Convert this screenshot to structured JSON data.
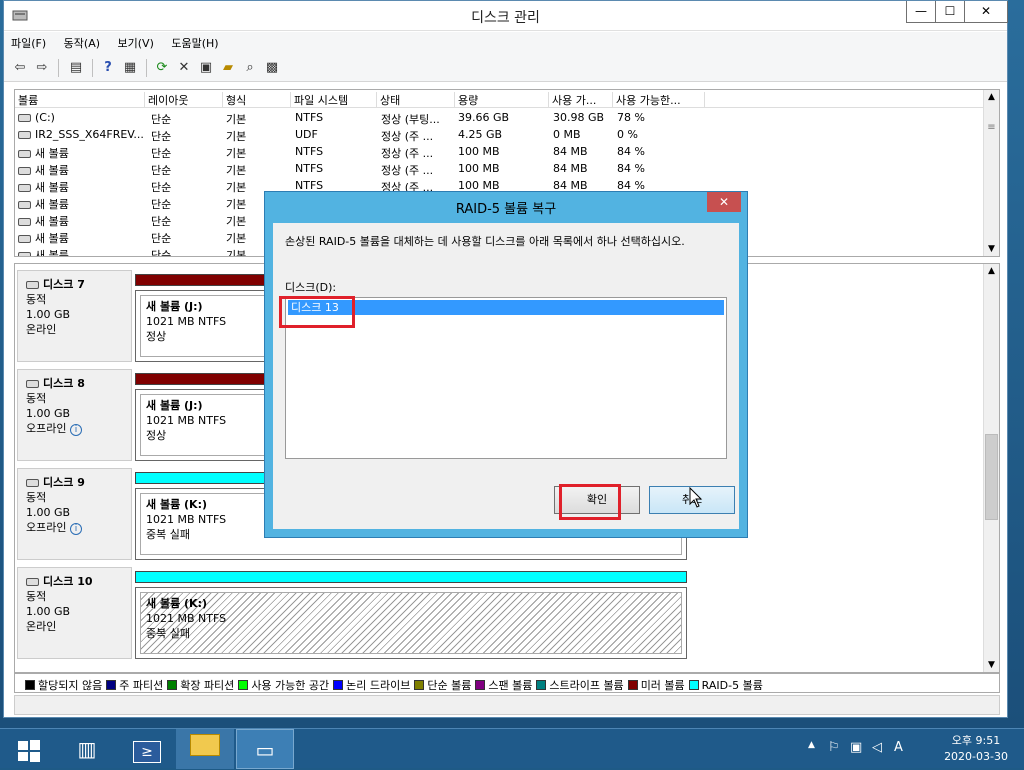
{
  "window": {
    "title": "디스크 관리",
    "buttons": {
      "min": "—",
      "max": "☐",
      "close": "✕"
    }
  },
  "menu": [
    "파일(F)",
    "동작(A)",
    "보기(V)",
    "도움말(H)"
  ],
  "volume_table": {
    "columns": [
      "볼륨",
      "레이아웃",
      "형식",
      "파일 시스템",
      "상태",
      "용량",
      "사용 가...",
      "사용 가능한..."
    ],
    "rows": [
      [
        "(C:)",
        "단순",
        "기본",
        "NTFS",
        "정상 (부팅...",
        "39.66 GB",
        "30.98 GB",
        "78 %"
      ],
      [
        "IR2_SSS_X64FREV...",
        "단순",
        "기본",
        "UDF",
        "정상 (주 ...",
        "4.25 GB",
        "0 MB",
        "0 %"
      ],
      [
        "새 볼륨",
        "단순",
        "기본",
        "NTFS",
        "정상 (주 ...",
        "100 MB",
        "84 MB",
        "84 %"
      ],
      [
        "새 볼륨",
        "단순",
        "기본",
        "NTFS",
        "정상 (주 ...",
        "100 MB",
        "84 MB",
        "84 %"
      ],
      [
        "새 볼륨",
        "단순",
        "기본",
        "NTFS",
        "정상 (주 ...",
        "100 MB",
        "84 MB",
        "84 %"
      ],
      [
        "새 볼륨",
        "단순",
        "기본",
        "",
        "",
        "",
        "",
        ""
      ],
      [
        "새 볼륨",
        "단순",
        "기본",
        "",
        "",
        "",
        "",
        ""
      ],
      [
        "새 볼륨",
        "단순",
        "기본",
        "",
        "",
        "",
        "",
        ""
      ],
      [
        "새 볼륨",
        "단순",
        "기본",
        "",
        "",
        "",
        "",
        ""
      ]
    ]
  },
  "disks": [
    {
      "name": "디스크 7",
      "type": "동적",
      "size": "1.00 GB",
      "status": "온라인",
      "bar_color": "#800000",
      "part_name": "새 볼륨  (J:)",
      "part_size": "1021 MB NTFS",
      "part_status": "정상",
      "hatched": false,
      "info": false
    },
    {
      "name": "디스크 8",
      "type": "동적",
      "size": "1.00 GB",
      "status": "오프라인",
      "bar_color": "#800000",
      "part_name": "새 볼륨  (J:)",
      "part_size": "1021 MB NTFS",
      "part_status": "정상",
      "hatched": false,
      "info": true
    },
    {
      "name": "디스크 9",
      "type": "동적",
      "size": "1.00 GB",
      "status": "오프라인",
      "bar_color": "#00ffff",
      "part_name": "새 볼륨  (K:)",
      "part_size": "1021 MB NTFS",
      "part_status": "중복 실패",
      "hatched": false,
      "info": true
    },
    {
      "name": "디스크 10",
      "type": "동적",
      "size": "1.00 GB",
      "status": "온라인",
      "bar_color": "#00ffff",
      "part_name": "새 볼륨  (K:)",
      "part_size": "1021 MB NTFS",
      "part_status": "중복 실패",
      "hatched": true,
      "info": false
    }
  ],
  "legend": [
    {
      "label": "할당되지 않음",
      "color": "#000000"
    },
    {
      "label": "주 파티션",
      "color": "#000080"
    },
    {
      "label": "확장 파티션",
      "color": "#008000"
    },
    {
      "label": "사용 가능한 공간",
      "color": "#00ff00"
    },
    {
      "label": "논리 드라이브",
      "color": "#0000ff"
    },
    {
      "label": "단순 볼륨",
      "color": "#808000"
    },
    {
      "label": "스팬 볼륨",
      "color": "#800080"
    },
    {
      "label": "스트라이프 볼륨",
      "color": "#008080"
    },
    {
      "label": "미러 볼륨",
      "color": "#800000"
    },
    {
      "label": "RAID-5 볼륨",
      "color": "#00ffff"
    }
  ],
  "dialog": {
    "title": "RAID-5 볼륨 복구",
    "close": "✕",
    "message": "손상된 RAID-5 볼륨을 대체하는 데 사용할 디스크를 아래 목록에서 하나 선택하십시오.",
    "list_label": "디스크(D):",
    "list_items": [
      "디스크 13"
    ],
    "ok_label": "확인",
    "cancel_label": "취소"
  },
  "taskbar": {
    "clock_time": "오후 9:51",
    "clock_date": "2020-03-30",
    "ime": "A"
  }
}
